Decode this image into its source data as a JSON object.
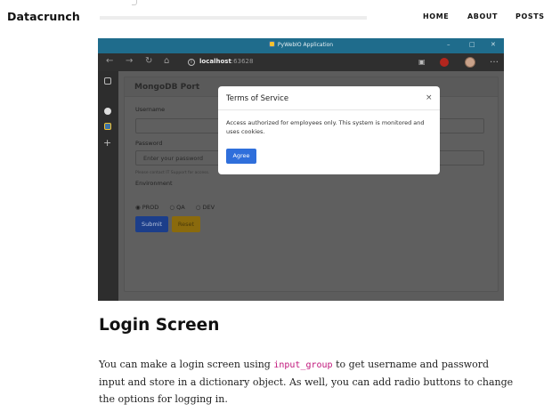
{
  "site": {
    "brand": "Datacrunch",
    "nav": [
      "HOME",
      "ABOUT",
      "POSTS"
    ]
  },
  "window": {
    "title": "PyWebIO Application",
    "controls": [
      "–",
      "□",
      "✕"
    ],
    "url_host": "localhost",
    "url_port": ":63628"
  },
  "form": {
    "title": "MongoDB Port",
    "username_label": "Username",
    "password_label": "Password",
    "password_placeholder": "Enter your password",
    "help_text": "Please contact IT Support for access.",
    "environment_label": "Environment",
    "radio_options": [
      "PROD",
      "QA",
      "DEV"
    ],
    "selected_option": "PROD",
    "submit_label": "Submit",
    "reset_label": "Reset"
  },
  "modal": {
    "title": "Terms of Service",
    "close_symbol": "×",
    "body": "Access authorized for employees only. This system is monitored and uses cookies.",
    "button_label": "Agree"
  },
  "article": {
    "heading": "Login Screen",
    "para_part1": "You can make a login screen using ",
    "para_code": "input_group",
    "para_part2": " to get username and password input and store in a dictionary object. As well, you can add radio buttons to change the options for logging in."
  },
  "colors": {
    "titlebar": "#1f6c8c",
    "code_text": "#c0147a",
    "agree_button": "#2f6fdb"
  }
}
